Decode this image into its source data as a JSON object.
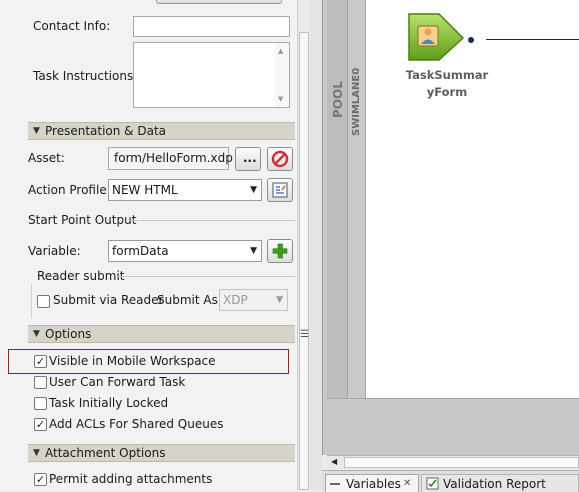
{
  "form": {
    "contact_info_label": "Contact Info:",
    "contact_info_value": "",
    "task_instructions_label": "Task Instructions:",
    "task_instructions_value": ""
  },
  "presentation": {
    "header": "Presentation & Data",
    "asset_label": "Asset:",
    "asset_value": "form/HelloForm.xdp",
    "browse_button": "...",
    "action_profile_label": "Action Profile:",
    "action_profile_value": "NEW HTML"
  },
  "start_point_output": {
    "header": "Start Point Output",
    "variable_label": "Variable:",
    "variable_value": "formData",
    "reader_submit_header": "Reader submit",
    "submit_via_reader_label": "Submit via Reader",
    "submit_via_reader_checked": false,
    "submit_as_label": "Submit As:",
    "submit_as_value": "XDP"
  },
  "options": {
    "header": "Options",
    "items": [
      {
        "label": "Visible in Mobile Workspace",
        "checked": true,
        "highlighted": true
      },
      {
        "label": "User Can Forward Task",
        "checked": false
      },
      {
        "label": "Task Initially Locked",
        "checked": false
      },
      {
        "label": "Add ACLs For Shared Queues",
        "checked": true
      }
    ]
  },
  "attachment_options": {
    "header": "Attachment Options",
    "items": [
      {
        "label": "Permit adding attachments",
        "checked": true
      }
    ]
  },
  "canvas": {
    "pool_label": "POOL",
    "swimlane_label": "SWIMLANE0",
    "node_label_line1": "TaskSummar",
    "node_label_line2": "yForm"
  },
  "bottom_tabs": [
    {
      "label": "Variables",
      "close": "✕"
    },
    {
      "label": "Validation Report"
    }
  ],
  "colors": {
    "highlight_border": "#7b2d1e",
    "section_header_bg": "#d6d3c8",
    "start_node_green": "#7cbf2a",
    "add_button_green": "#3aa019",
    "remove_button_red": "#c8303a"
  },
  "icons": [
    "remove-icon",
    "edit-profile-icon",
    "add-icon",
    "user-icon",
    "collapse-triangle-icon",
    "dropdown-arrow-icon",
    "close-icon",
    "validation-icon"
  ]
}
